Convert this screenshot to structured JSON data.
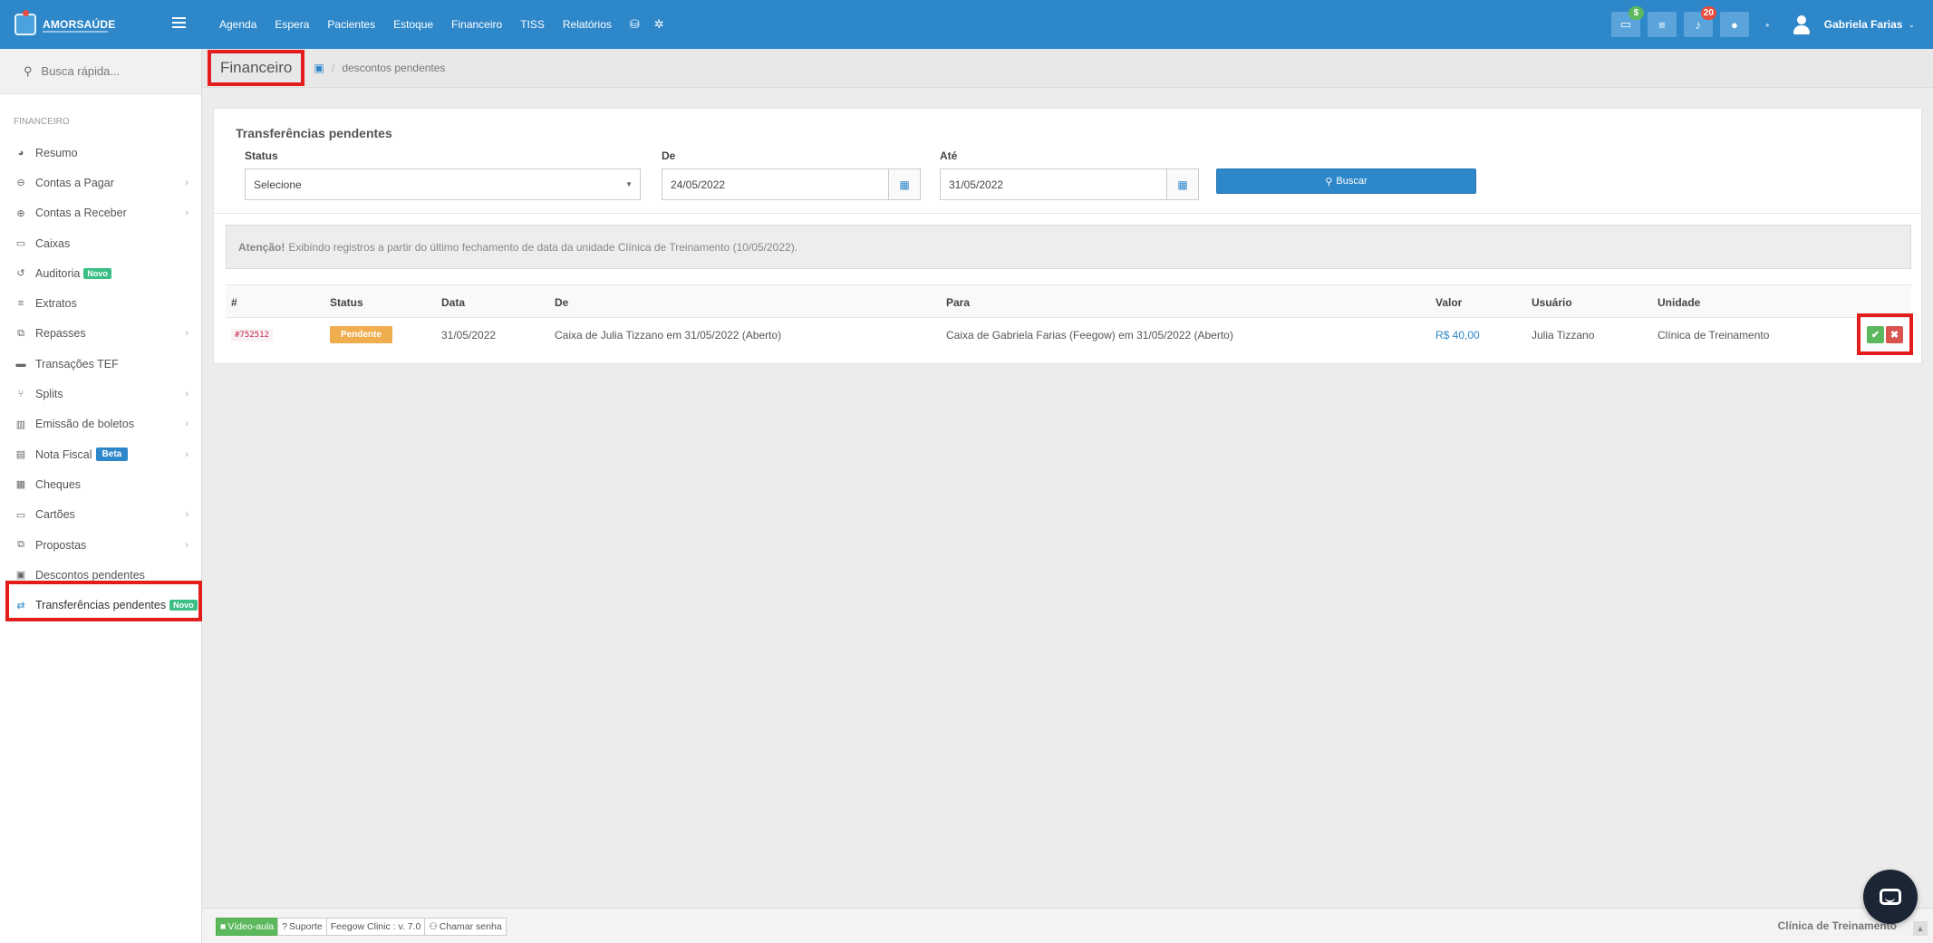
{
  "brand": {
    "name": "AMORSAÚDE"
  },
  "topnav": {
    "items": [
      "Agenda",
      "Espera",
      "Pacientes",
      "Estoque",
      "Financeiro",
      "TISS",
      "Relatórios"
    ]
  },
  "topright": {
    "badge_money": "$",
    "badge_notifications": "20",
    "user_name": "Gabriela Farias"
  },
  "sidebar": {
    "search_placeholder": "Busca rápida...",
    "section": "FINANCEIRO",
    "items": [
      {
        "label": "Resumo",
        "icon": "pie-chart-icon",
        "glyph": "◕"
      },
      {
        "label": "Contas a Pagar",
        "icon": "minus-circle-icon",
        "glyph": "⊖",
        "chevron": true
      },
      {
        "label": "Contas a Receber",
        "icon": "plus-circle-icon",
        "glyph": "⊕",
        "chevron": true
      },
      {
        "label": "Caixas",
        "icon": "inbox-icon",
        "glyph": "▭"
      },
      {
        "label": "Auditoria",
        "icon": "history-icon",
        "glyph": "↺",
        "tag": "Novo"
      },
      {
        "label": "Extratos",
        "icon": "list-icon",
        "glyph": "≡"
      },
      {
        "label": "Repasses",
        "icon": "sitemap-icon",
        "glyph": "⧉",
        "chevron": true
      },
      {
        "label": "Transações TEF",
        "icon": "credit-card-icon",
        "glyph": "▬"
      },
      {
        "label": "Splits",
        "icon": "split-icon",
        "glyph": "⑂",
        "chevron": true
      },
      {
        "label": "Emissão de boletos",
        "icon": "barcode-icon",
        "glyph": "▥",
        "chevron": true
      },
      {
        "label": "Nota Fiscal",
        "icon": "file-icon",
        "glyph": "▤",
        "tag_beta": "Beta",
        "chevron": true
      },
      {
        "label": "Cheques",
        "icon": "check-money-icon",
        "glyph": "▦"
      },
      {
        "label": "Cartões",
        "icon": "card-icon",
        "glyph": "▭",
        "chevron": true
      },
      {
        "label": "Propostas",
        "icon": "copy-icon",
        "glyph": "⧉",
        "chevron": true
      },
      {
        "label": "Descontos pendentes",
        "icon": "money-icon",
        "glyph": "▣"
      },
      {
        "label": "Transferências pendentes",
        "icon": "exchange-icon",
        "glyph": "⇄",
        "tag": "Novo"
      }
    ]
  },
  "breadcrumb": {
    "title": "Financeiro",
    "current": "descontos pendentes"
  },
  "panel": {
    "title": "Transferências pendentes",
    "status_label": "Status",
    "status_value": "Selecione",
    "de_label": "De",
    "de_value": "24/05/2022",
    "ate_label": "Até",
    "ate_value": "31/05/2022",
    "search_button": "Buscar",
    "alert_strong": "Atenção!",
    "alert_text": "Exibindo registros a partir do último fechamento de data da unidade Clínica de Treinamento (10/05/2022)."
  },
  "table": {
    "headers": [
      "#",
      "Status",
      "Data",
      "De",
      "Para",
      "Valor",
      "Usuário",
      "Unidade"
    ],
    "rows": [
      {
        "id": "#752512",
        "status": "Pendente",
        "data": "31/05/2022",
        "de": "Caixa de Julia Tizzano em 31/05/2022 (Aberto)",
        "para": "Caixa de Gabriela Farias (Feegow) em 31/05/2022 (Aberto)",
        "valor": "R$ 40,00",
        "usuario": "Julia Tizzano",
        "unidade": "Clínica de Treinamento"
      }
    ]
  },
  "footer": {
    "video": "Vídeo-aula",
    "suporte": "Suporte",
    "version": "Feegow Clinic : v. 7.0",
    "chamar": "Chamar senha",
    "unit": "Clínica de Treinamento"
  },
  "colors": {
    "primary": "#2d87c9",
    "success": "#5cb85c",
    "danger": "#d9534f",
    "warning": "#f0ad4e",
    "highlight": "#e31c1c"
  }
}
